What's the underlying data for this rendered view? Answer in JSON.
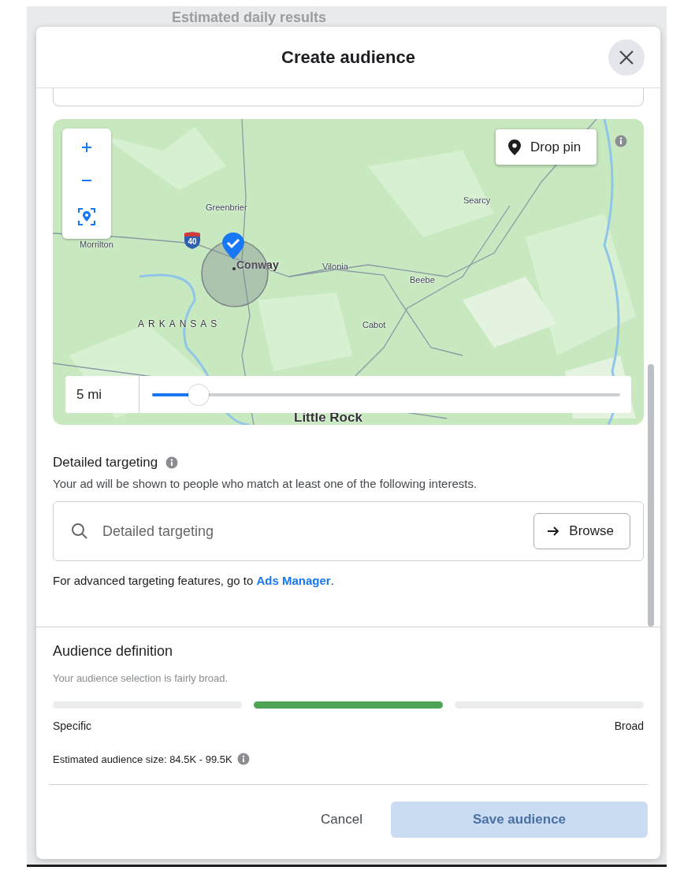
{
  "background": {
    "text": "Estimated daily results"
  },
  "dialog": {
    "title": "Create audience",
    "map": {
      "place_labels": [
        {
          "text": "Greenbrier",
          "kind": "town"
        },
        {
          "text": "Searcy",
          "kind": "town"
        },
        {
          "text": "Morrilton",
          "kind": "town"
        },
        {
          "text": "Conway",
          "kind": "city"
        },
        {
          "text": "Vilonia",
          "kind": "town"
        },
        {
          "text": "Beebe",
          "kind": "town"
        },
        {
          "text": "ARKANSAS",
          "kind": "state"
        },
        {
          "text": "Cabot",
          "kind": "town"
        },
        {
          "text": "Little Rock",
          "kind": "capital"
        }
      ],
      "highway_shield": "40",
      "drop_pin": "Drop pin",
      "radius": {
        "value": "5 mi",
        "level": 0.1
      }
    },
    "detailed_targeting": {
      "title": "Detailed targeting",
      "description": "Your ad will be shown to people who match at least one of the following interests.",
      "search": {
        "placeholder": "Detailed targeting"
      },
      "browse": "Browse",
      "footnote": "For advanced targeting features, go to ",
      "footnote_link": "Ads Manager",
      "footnote_end": "."
    },
    "audience_definition": {
      "title": "Audience definition",
      "summary": "Your audience selection is fairly broad.",
      "meter": [
        {
          "selected": false
        },
        {
          "selected": true
        },
        {
          "selected": false
        }
      ],
      "min_label": "Specific",
      "max_label": "Broad",
      "estimate": "Estimated audience size: 84.5K - 99.5K"
    },
    "footer": {
      "cancel": "Cancel",
      "save": {
        "label": "Save audience",
        "disabled": true
      }
    }
  }
}
